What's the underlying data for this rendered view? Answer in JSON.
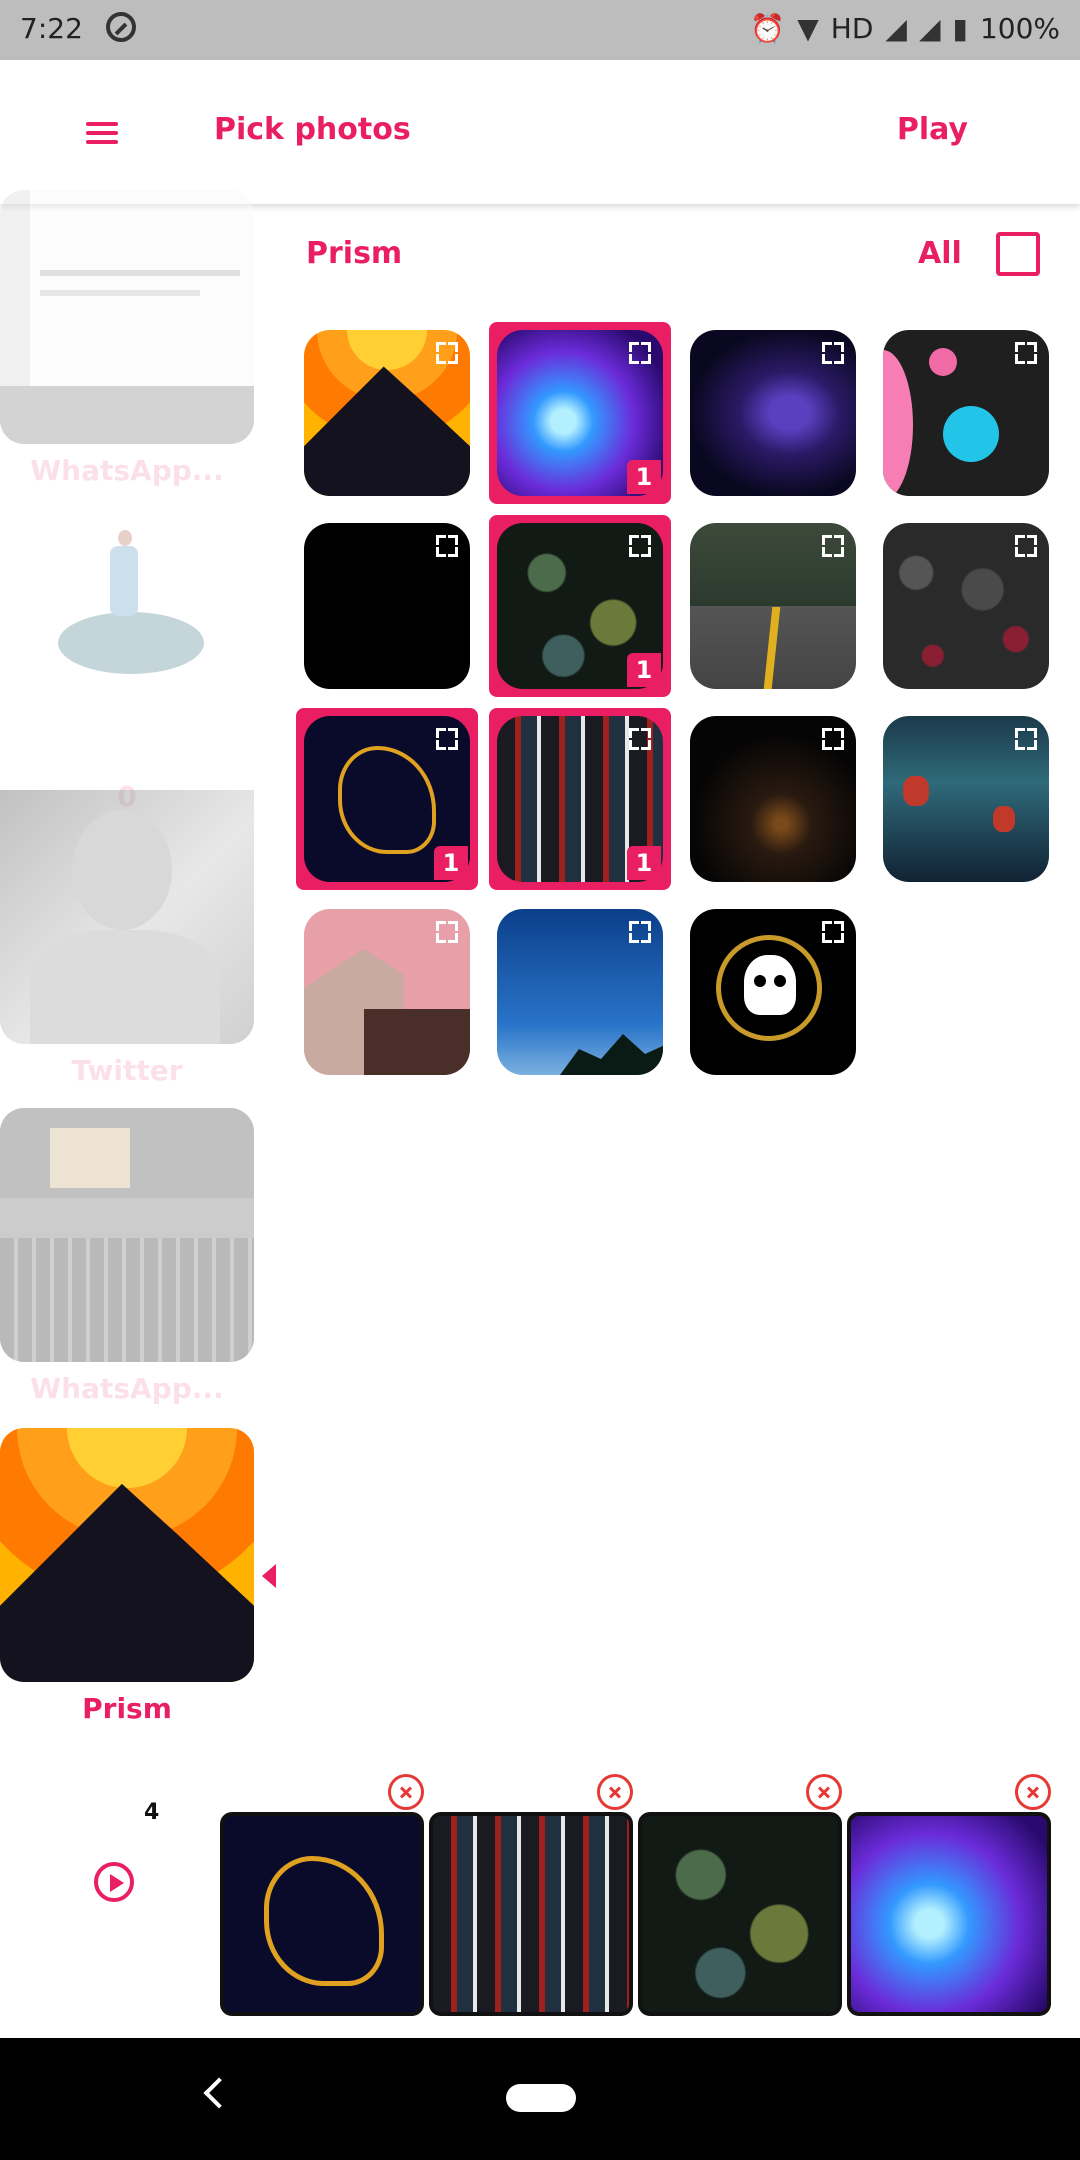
{
  "status": {
    "time": "7:22",
    "network": "HD",
    "battery": "100%"
  },
  "appbar": {
    "title": "Pick photos",
    "play_label": "Play"
  },
  "sidebar": {
    "albums": [
      {
        "label": "WhatsApp..."
      },
      {
        "label": "0"
      },
      {
        "label": "Twitter"
      },
      {
        "label": "WhatsApp..."
      },
      {
        "label": "Prism"
      }
    ]
  },
  "main": {
    "folder_title": "Prism",
    "all_label": "All",
    "badge": "1"
  },
  "bottom": {
    "count": "4"
  },
  "colors": {
    "accent": "#e91e63"
  }
}
